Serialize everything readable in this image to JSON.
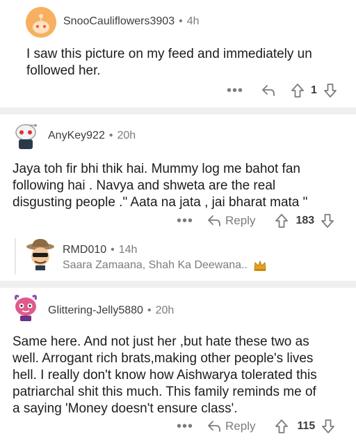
{
  "comments": [
    {
      "username": "SnooCauliflowers3903",
      "time": "4h",
      "body_lines": [
        "I saw this picture on my feed and immediately un",
        "followed her."
      ],
      "votes": "1"
    },
    {
      "username": "AnyKey922",
      "time": "20h",
      "body_lines": [
        "Jaya toh fir bhi thik hai. Mummy log me bahot fan",
        "following hai . Navya and shweta are the real",
        "disgusting people .\" Aata na jata , jai bharat mata \""
      ],
      "reply_label": "Reply",
      "votes": "183"
    },
    {
      "username": "Glittering-Jelly5880",
      "time": "20h",
      "body_lines": [
        "Same here. And not just her ,but hate these two as",
        "well. Arrogant rich brats,making other people's lives",
        "hell. I really don't know how Aishwarya tolerated this",
        "patriarchal shit this much. This family reminds me of",
        "a saying 'Money doesn't ensure class'."
      ],
      "reply_label": "Reply",
      "votes": "115"
    }
  ],
  "collapsed_reply": {
    "username": "RMD010",
    "time": "14h",
    "preview": "Saara Zamaana, Shah Ka Deewana.."
  },
  "separator": "•",
  "more_glyph": "•••",
  "colors": {
    "divider": "#edeff1",
    "meta_gray": "#7c7c7c",
    "snoo_orange": "#f7b05f",
    "crown": "#e8a21a"
  }
}
